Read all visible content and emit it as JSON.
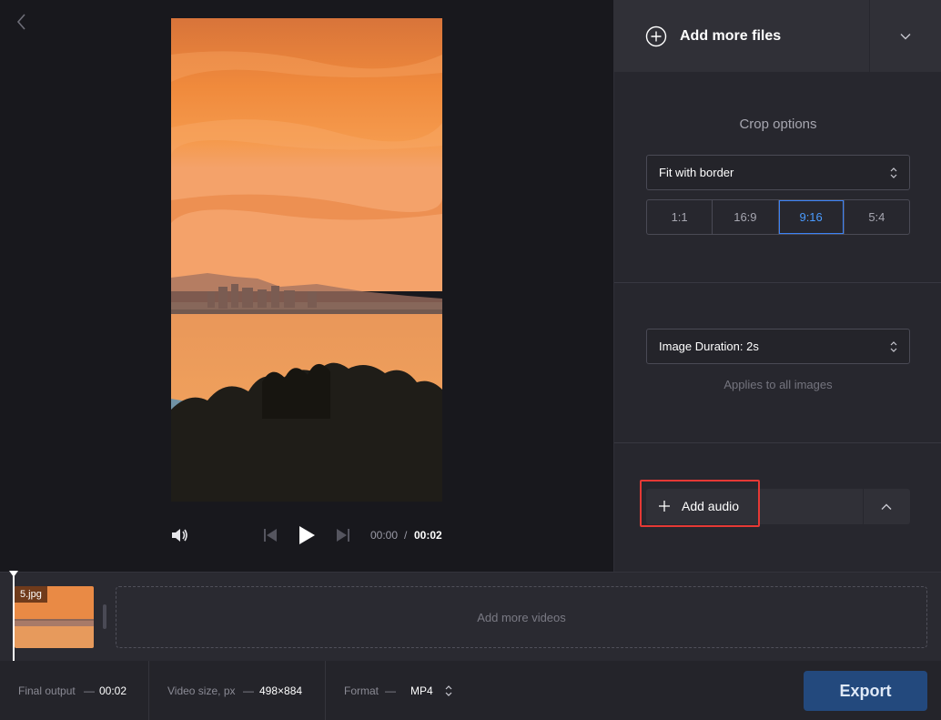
{
  "preview": {
    "time_current": "00:00",
    "time_separator": "/",
    "time_total": "00:02"
  },
  "panel": {
    "add_files_label": "Add more files",
    "crop_title": "Crop options",
    "crop_mode": "Fit with border",
    "ratios": [
      "1:1",
      "16:9",
      "9:16",
      "5:4"
    ],
    "active_ratio": "9:16",
    "image_duration": "Image Duration: 2s",
    "applies_note": "Applies to all images",
    "add_audio_label": "Add audio"
  },
  "timeline": {
    "clip_name": "5.jpg",
    "add_videos_label": "Add more videos"
  },
  "footer": {
    "final_output_label": "Final output",
    "final_output_value": "00:02",
    "video_size_label": "Video size, px",
    "video_size_value": "498×884",
    "format_label": "Format",
    "format_value": "MP4",
    "dash": "—",
    "export_label": "Export"
  },
  "colors": {
    "accent": "#3b82f6",
    "export": "#23497d",
    "highlight": "#e53935"
  },
  "icons": [
    "chevron-left-icon",
    "volume-icon",
    "skip-back-icon",
    "play-icon",
    "skip-forward-icon",
    "plus-circle-icon",
    "chevron-down-icon",
    "select-caret-icon",
    "plus-icon",
    "chevron-up-icon"
  ]
}
